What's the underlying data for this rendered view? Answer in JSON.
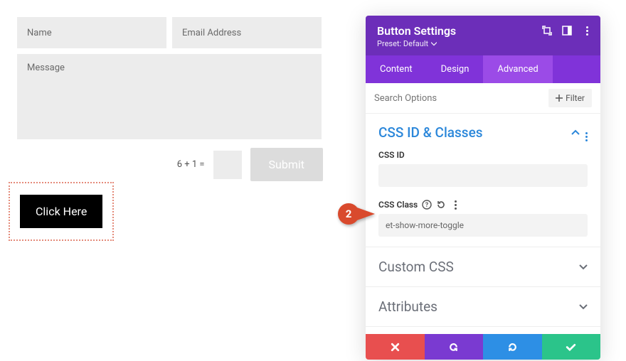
{
  "form": {
    "name_placeholder": "Name",
    "email_placeholder": "Email Address",
    "message_placeholder": "Message",
    "captcha_label": "6 + 1 =",
    "submit_label": "Submit"
  },
  "click_here_label": "Click Here",
  "panel": {
    "title": "Button Settings",
    "preset_label": "Preset: Default",
    "tabs": {
      "content": "Content",
      "design": "Design",
      "advanced": "Advanced"
    },
    "search_placeholder": "Search Options",
    "filter_label": "Filter",
    "section_css_id_classes": "CSS ID & Classes",
    "field_css_id_label": "CSS ID",
    "field_css_id_value": "",
    "field_css_class_label": "CSS Class",
    "field_css_class_value": "et-show-more-toggle",
    "section_custom_css": "Custom CSS",
    "section_attributes": "Attributes"
  },
  "callout_number": "2"
}
